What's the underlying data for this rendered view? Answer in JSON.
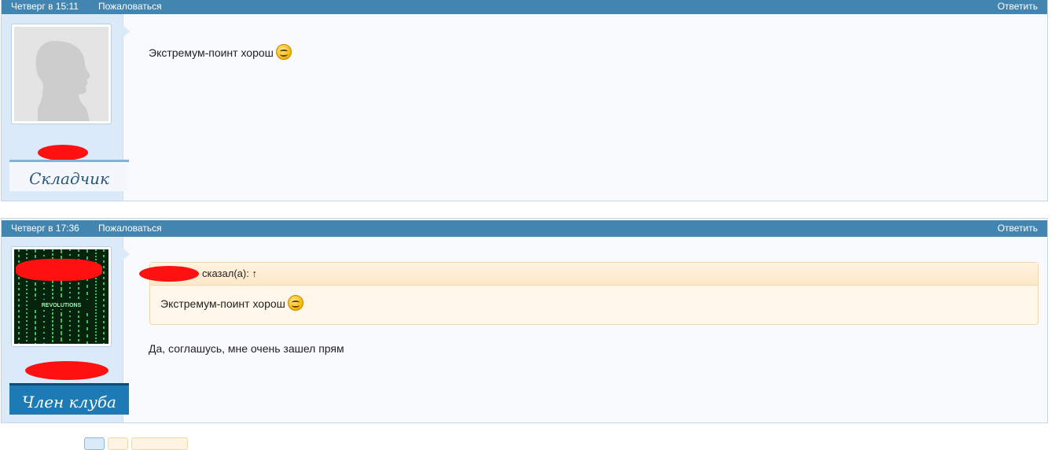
{
  "posts": [
    {
      "date": "Четверг в 15:11",
      "complain": "Пожаловаться",
      "reply": "Ответить",
      "rank": "Складчик",
      "text": "Экстремум-поинт хорош"
    },
    {
      "date": "Четверг в 17:36",
      "complain": "Пожаловаться",
      "reply": "Ответить",
      "rank": "Член клуба",
      "avatar_caption": "REVOLUTIONS",
      "quote_author_suffix": "сказал(а):",
      "quote_arrow": "↑",
      "quote_text": "Экстремум-поинт хорош",
      "text": "Да, соглашусь, мне очень зашел прям"
    }
  ],
  "icons": {
    "smiley": "smiley-icon",
    "redaction": "red-redaction-mark"
  },
  "colors": {
    "header": "#4285b0",
    "sidebar": "#dbeaf8",
    "quote_bg": "#fff7e9",
    "redaction": "#ff1111"
  }
}
